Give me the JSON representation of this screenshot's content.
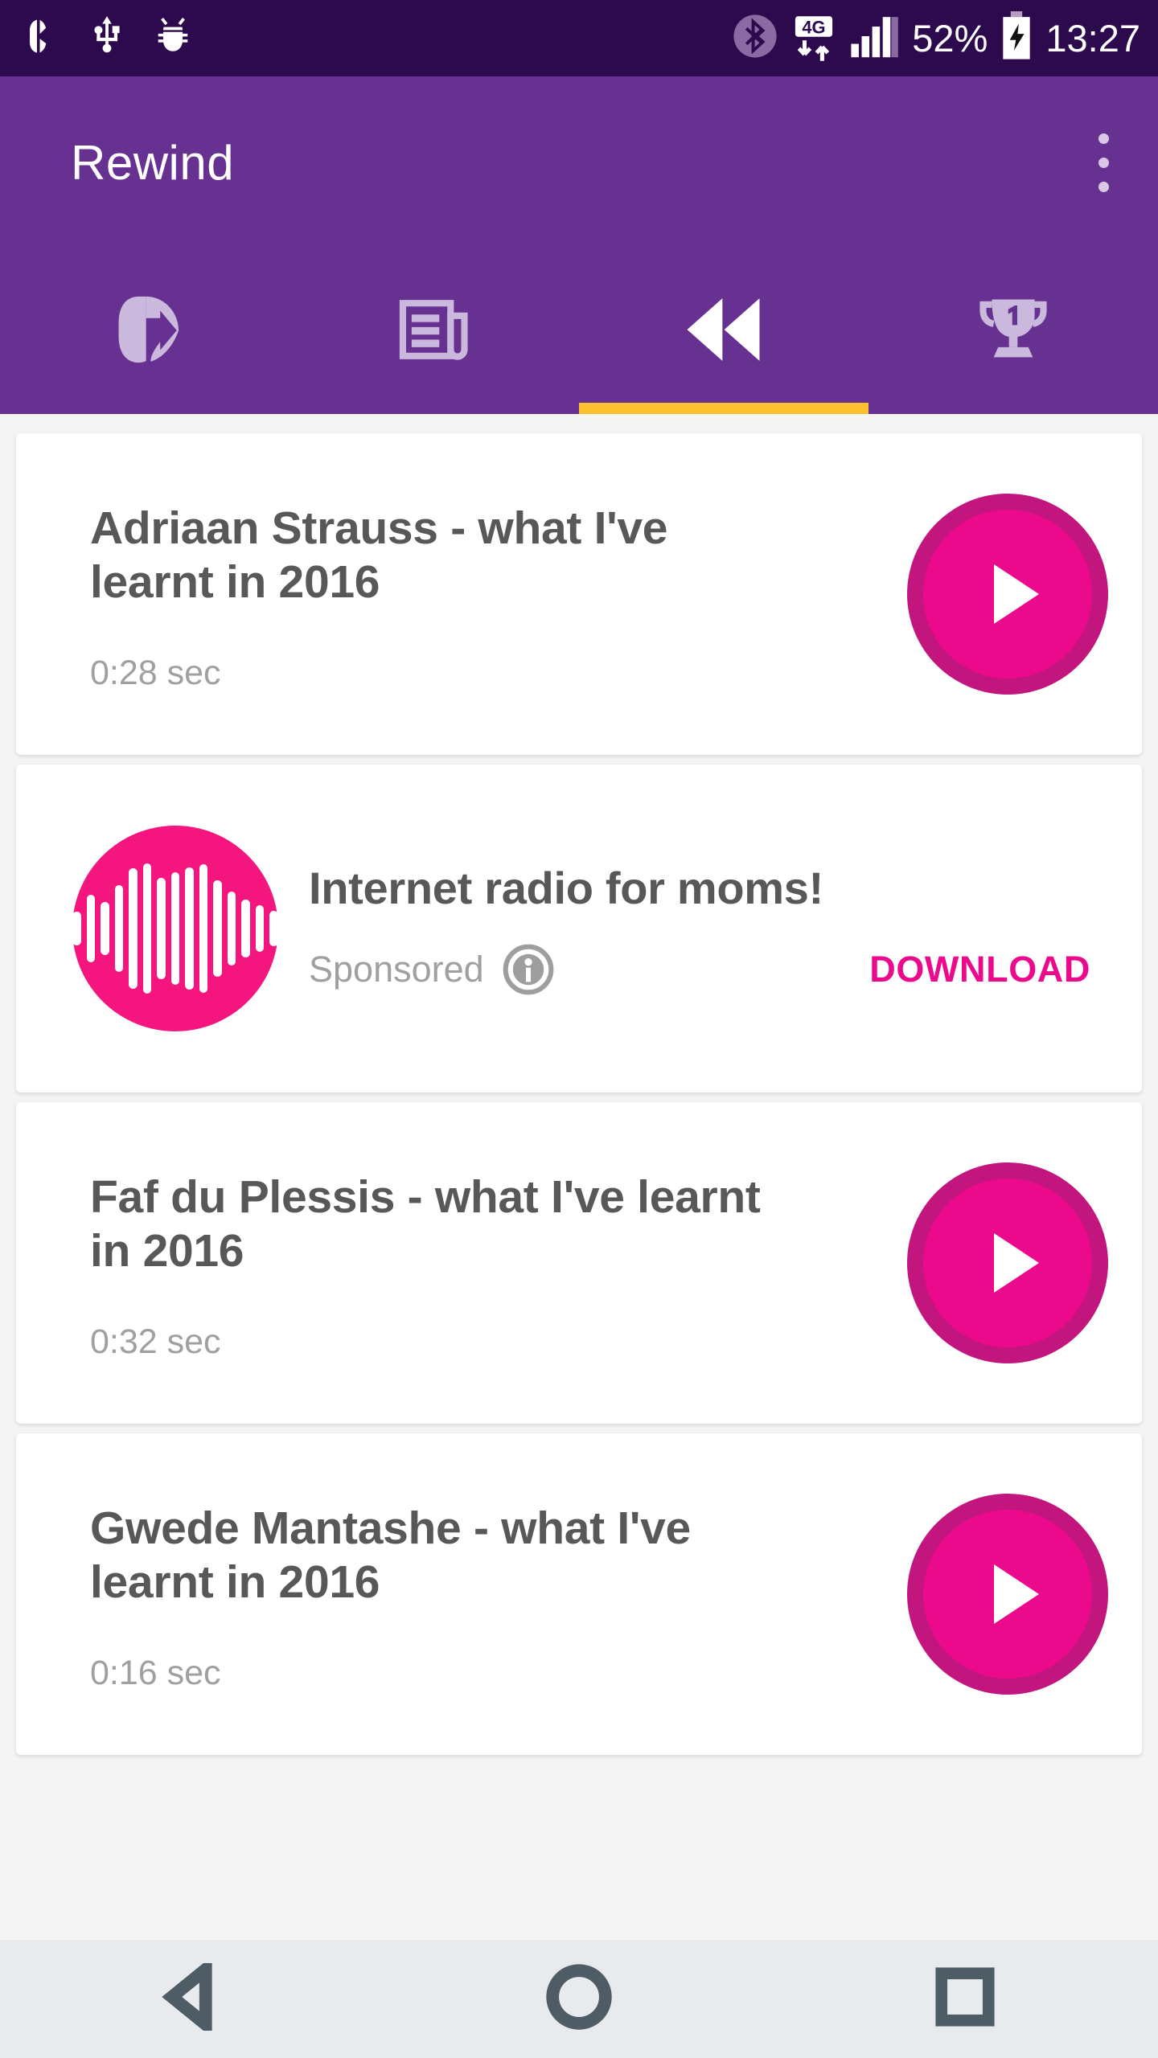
{
  "status_bar": {
    "left_icons": [
      "app-notification-icon",
      "usb-icon",
      "android-debug-bug-icon"
    ],
    "bluetooth_icon": "bluetooth-icon",
    "network_type": "4G",
    "signal_icon": "signal-bars-icon",
    "battery_percent": "52%",
    "battery_icon": "battery-charging-icon",
    "time": "13:27",
    "background": "#2d0a4e"
  },
  "app_bar": {
    "title": "Rewind",
    "overflow_menu": "more-options",
    "background": "#673192",
    "indicator_color": "#fbc02d"
  },
  "tabs": [
    {
      "name": "home",
      "icon": "app-logo-icon",
      "active": false
    },
    {
      "name": "news",
      "icon": "newspaper-icon",
      "active": false
    },
    {
      "name": "rewind",
      "icon": "rewind-icon",
      "active": true
    },
    {
      "name": "leaderboard",
      "icon": "trophy-icon",
      "active": false
    }
  ],
  "list": [
    {
      "type": "episode",
      "title": "Adriaan Strauss - what I've learnt in 2016",
      "duration": "0:28 sec",
      "play_icon": "play-icon"
    },
    {
      "type": "ad",
      "title": "Internet radio for moms!",
      "sponsored_label": "Sponsored",
      "adchoices_icon": "ad-info-icon",
      "cta": "DOWNLOAD",
      "icon": "audio-waveform-icon",
      "icon_color": "#f5157f",
      "cta_color": "#ec0a8c"
    },
    {
      "type": "episode",
      "title": "Faf du Plessis - what I've learnt in 2016",
      "duration": "0:32 sec",
      "play_icon": "play-icon"
    },
    {
      "type": "episode",
      "title": "Gwede Mantashe - what I've learnt in 2016",
      "duration": "0:16 sec",
      "play_icon": "play-icon"
    }
  ],
  "nav_bar": {
    "back": "back-triangle-icon",
    "home": "home-circle-icon",
    "recents": "recents-square-icon",
    "background": "#e8eaed"
  },
  "theme": {
    "accent_magenta": "#ec0a8c",
    "accent_magenta_dark": "#c2157e",
    "purple": "#673192",
    "purple_dark": "#2d0a4e",
    "amber": "#fbc02d",
    "card_bg": "#ffffff",
    "page_bg": "#f4f4f4",
    "title_text": "#585858",
    "muted_text": "#a0a0a0"
  }
}
